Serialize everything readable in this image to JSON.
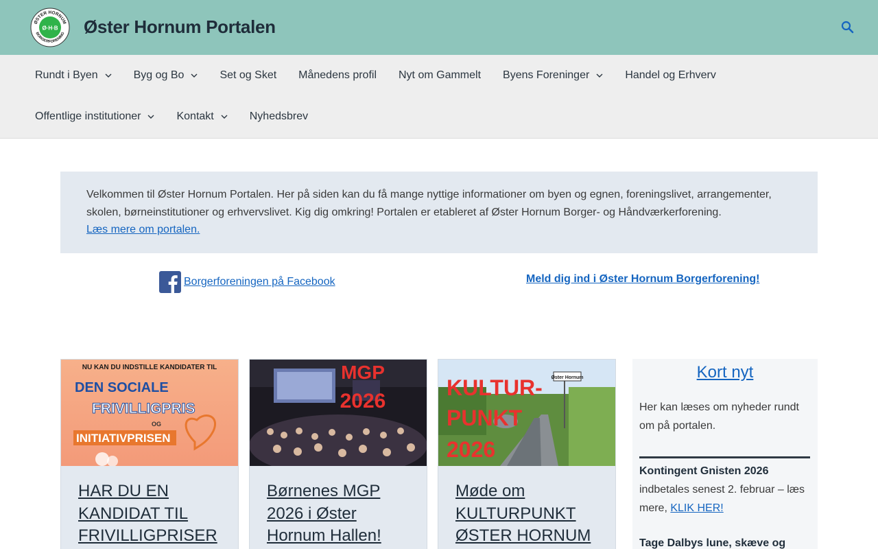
{
  "header": {
    "site_title": "Øster Hornum Portalen",
    "logo_text_top": "ØSTER HORNUM",
    "logo_text_bottom": "BORGERFORENING",
    "logo_center": "Ø·H·B",
    "search_icon": "search-icon"
  },
  "nav": {
    "items": [
      {
        "label": "Rundt i Byen",
        "has_submenu": true
      },
      {
        "label": "Byg og Bo",
        "has_submenu": true
      },
      {
        "label": "Set og Sket",
        "has_submenu": false
      },
      {
        "label": "Månedens profil",
        "has_submenu": false
      },
      {
        "label": "Nyt om Gammelt",
        "has_submenu": false
      },
      {
        "label": "Byens Foreninger",
        "has_submenu": true
      },
      {
        "label": "Handel og Erhverv",
        "has_submenu": false
      },
      {
        "label": "Offentlige institutioner",
        "has_submenu": true
      },
      {
        "label": "Kontakt",
        "has_submenu": true
      },
      {
        "label": "Nyhedsbrev",
        "has_submenu": false
      }
    ]
  },
  "intro": {
    "text": "Velkommen til Øster Hornum Portalen. Her på siden kan du få mange nyttige informationer om byen og egnen, foreningslivet, arrangementer, skolen, børneinstitutioner og erhvervslivet. Kig dig omkring! Portalen er etableret af Øster Hornum Borger- og Håndværkerforening.",
    "link": "Læs mere om portalen."
  },
  "links": {
    "facebook": "Borgerforeningen på Facebook",
    "join": "Meld dig ind i Øster Hornum Borgerforening!"
  },
  "cards": [
    {
      "title": "HAR DU EN KANDIDAT TIL FRIVILLIGPRISER",
      "image_text": [
        "NU KAN DU INDSTILLE KANDIDATER TIL",
        "DEN SOCIALE",
        "FRIVILLIGPRIS",
        "OG",
        "INITIATIVPRISEN"
      ]
    },
    {
      "title": "Børnenes MGP 2026 i Øster Hornum Hallen!",
      "image_text": [
        "MGP",
        "2026"
      ]
    },
    {
      "title": "Møde om KULTURPUNKT ØSTER HORNUM",
      "image_text": [
        "KULTUR-",
        "PUNKT",
        "2026",
        "Øster Hornum"
      ]
    }
  ],
  "sidebar": {
    "title": "Kort nyt",
    "intro": "Her kan læses om nyheder rundt om på portalen.",
    "news1_title": "Kontingent Gnisten 2026",
    "news1_text": "indbetales senest 2. februar – læs mere,",
    "news1_link": "KLIK HER!",
    "news2_title": "Tage Dalbys lune, skæve og"
  },
  "colors": {
    "topbar": "#8ec5bb",
    "nav_bg": "#eeeeee",
    "link": "#1565c0",
    "panel": "#e3e9f0"
  }
}
